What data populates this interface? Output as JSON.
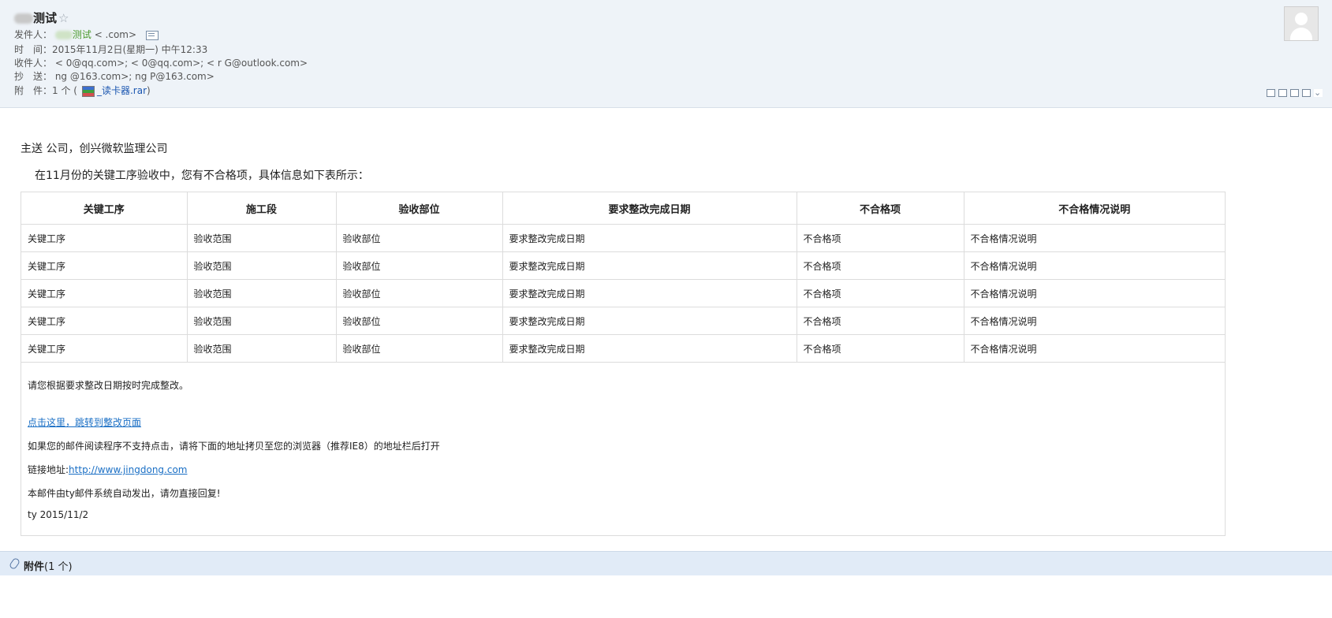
{
  "header": {
    "subject": "测试",
    "from_label": "发件人：",
    "from_name": "测试",
    "from_addr": "<                    .com>",
    "time_label": "时　间：",
    "time_value": "2015年11月2日(星期一) 中午12:33",
    "to_label": "收件人：",
    "to_value": "     <           0@qq.com>;       <           0@qq.com>;       <      r     G@outlook.com>",
    "cc_label": "抄　送：",
    "cc_value": "      ng             @163.com>;   ng               P@163.com>",
    "attach_label": "附　件：",
    "attach_count": "1 个 (",
    "attach_file": "_读卡器.rar",
    "attach_close": ")"
  },
  "body": {
    "greeting": "主送   公司，创兴微软监理公司",
    "intro": "在11月份的关键工序验收中，您有不合格项，具体信息如下表所示：",
    "table": {
      "headers": [
        "关键工序",
        "施工段",
        "验收部位",
        "要求整改完成日期",
        "不合格项",
        "不合格情况说明"
      ],
      "rows": [
        [
          "关键工序",
          "验收范围",
          "验收部位",
          "要求整改完成日期",
          "不合格项",
          "不合格情况说明"
        ],
        [
          "关键工序",
          "验收范围",
          "验收部位",
          "要求整改完成日期",
          "不合格项",
          "不合格情况说明"
        ],
        [
          "关键工序",
          "验收范围",
          "验收部位",
          "要求整改完成日期",
          "不合格项",
          "不合格情况说明"
        ],
        [
          "关键工序",
          "验收范围",
          "验收部位",
          "要求整改完成日期",
          "不合格项",
          "不合格情况说明"
        ],
        [
          "关键工序",
          "验收范围",
          "验收部位",
          "要求整改完成日期",
          "不合格项",
          "不合格情况说明"
        ]
      ]
    },
    "notice": "请您根据要求整改日期按时完成整改。",
    "jump_link": "点击这里，跳转到整改页面",
    "fallback": "如果您的邮件阅读程序不支持点击，请将下面的地址拷贝至您的浏览器（推荐IE8）的地址栏后打开",
    "url_label": "链接地址:",
    "url": "http://www.jingdong.com",
    "auto_note": "本邮件由ty邮件系统自动发出，请勿直接回复!",
    "signature": "ty 2015/11/2"
  },
  "attachments": {
    "title": "附件",
    "count": "(1 个)"
  }
}
